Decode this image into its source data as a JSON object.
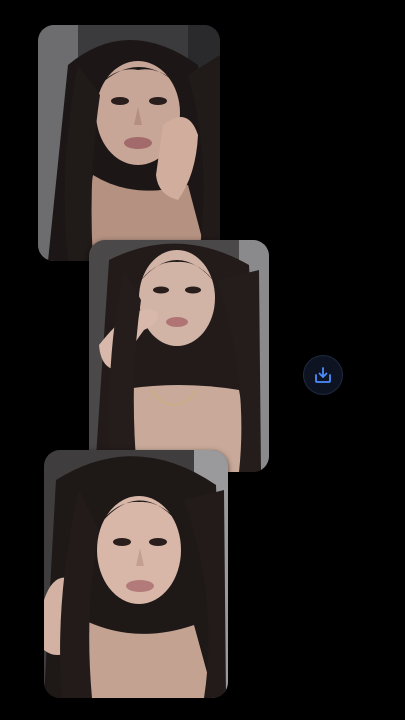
{
  "colors": {
    "background": "#000000",
    "accent": "#4a8dff",
    "button_bg": "#0d1320"
  },
  "photos": [
    {
      "icon": "photo",
      "description_visible": false
    },
    {
      "icon": "photo",
      "description_visible": false
    },
    {
      "icon": "photo",
      "description_visible": false
    }
  ],
  "actions": {
    "save_icon": "download-tray-icon"
  }
}
